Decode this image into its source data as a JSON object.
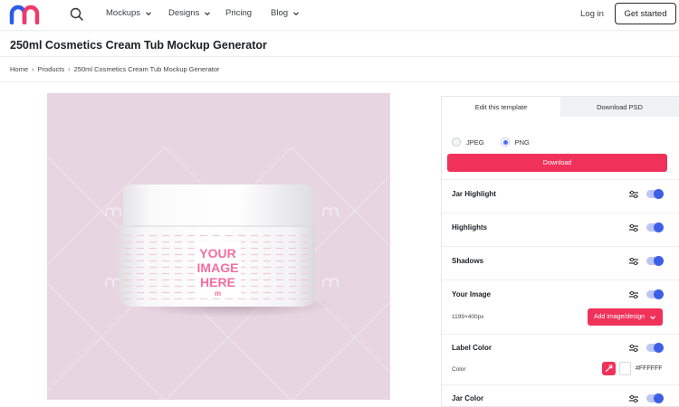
{
  "nav": {
    "logo": "m",
    "items": [
      {
        "label": "Mockups",
        "has_chevron": true
      },
      {
        "label": "Designs",
        "has_chevron": true
      },
      {
        "label": "Pricing",
        "has_chevron": false
      },
      {
        "label": "Blog",
        "has_chevron": true
      }
    ],
    "login": "Log in",
    "get_started": "Get started"
  },
  "page": {
    "title": "250ml Cosmetics Cream Tub Mockup Generator",
    "breadcrumb": [
      "Home",
      "Products",
      "250ml Cosmetics Cream Tub Mockup Generator"
    ]
  },
  "preview": {
    "background": "#e7d6e2",
    "label_text": [
      "YOUR",
      "IMAGE",
      "HERE"
    ],
    "label_mark": "m"
  },
  "panel": {
    "tabs": [
      {
        "label": "Edit this template",
        "active": true
      },
      {
        "label": "Download PSD",
        "active": false
      }
    ],
    "formats": [
      {
        "label": "JPEG",
        "selected": false
      },
      {
        "label": "PNG",
        "selected": true
      }
    ],
    "download_label": "Download",
    "sections": {
      "jar_highlight": {
        "title": "Jar Highlight",
        "enabled": true
      },
      "highlights": {
        "title": "Highlights",
        "enabled": true
      },
      "shadows": {
        "title": "Shadows",
        "enabled": true
      },
      "your_image": {
        "title": "Your Image",
        "enabled": true,
        "size": "1199×400px",
        "button": "Add image/design"
      },
      "label_color": {
        "title": "Label Color",
        "enabled": true,
        "field_label": "Color",
        "value": "#FFFFFF"
      },
      "jar_color": {
        "title": "Jar Color",
        "enabled": true
      }
    }
  },
  "colors": {
    "brand_pink": "#f0325b",
    "toggle_blue": "#3d5fe8",
    "logo_blue": "#2f5bea",
    "logo_pink": "#f03a6a"
  }
}
